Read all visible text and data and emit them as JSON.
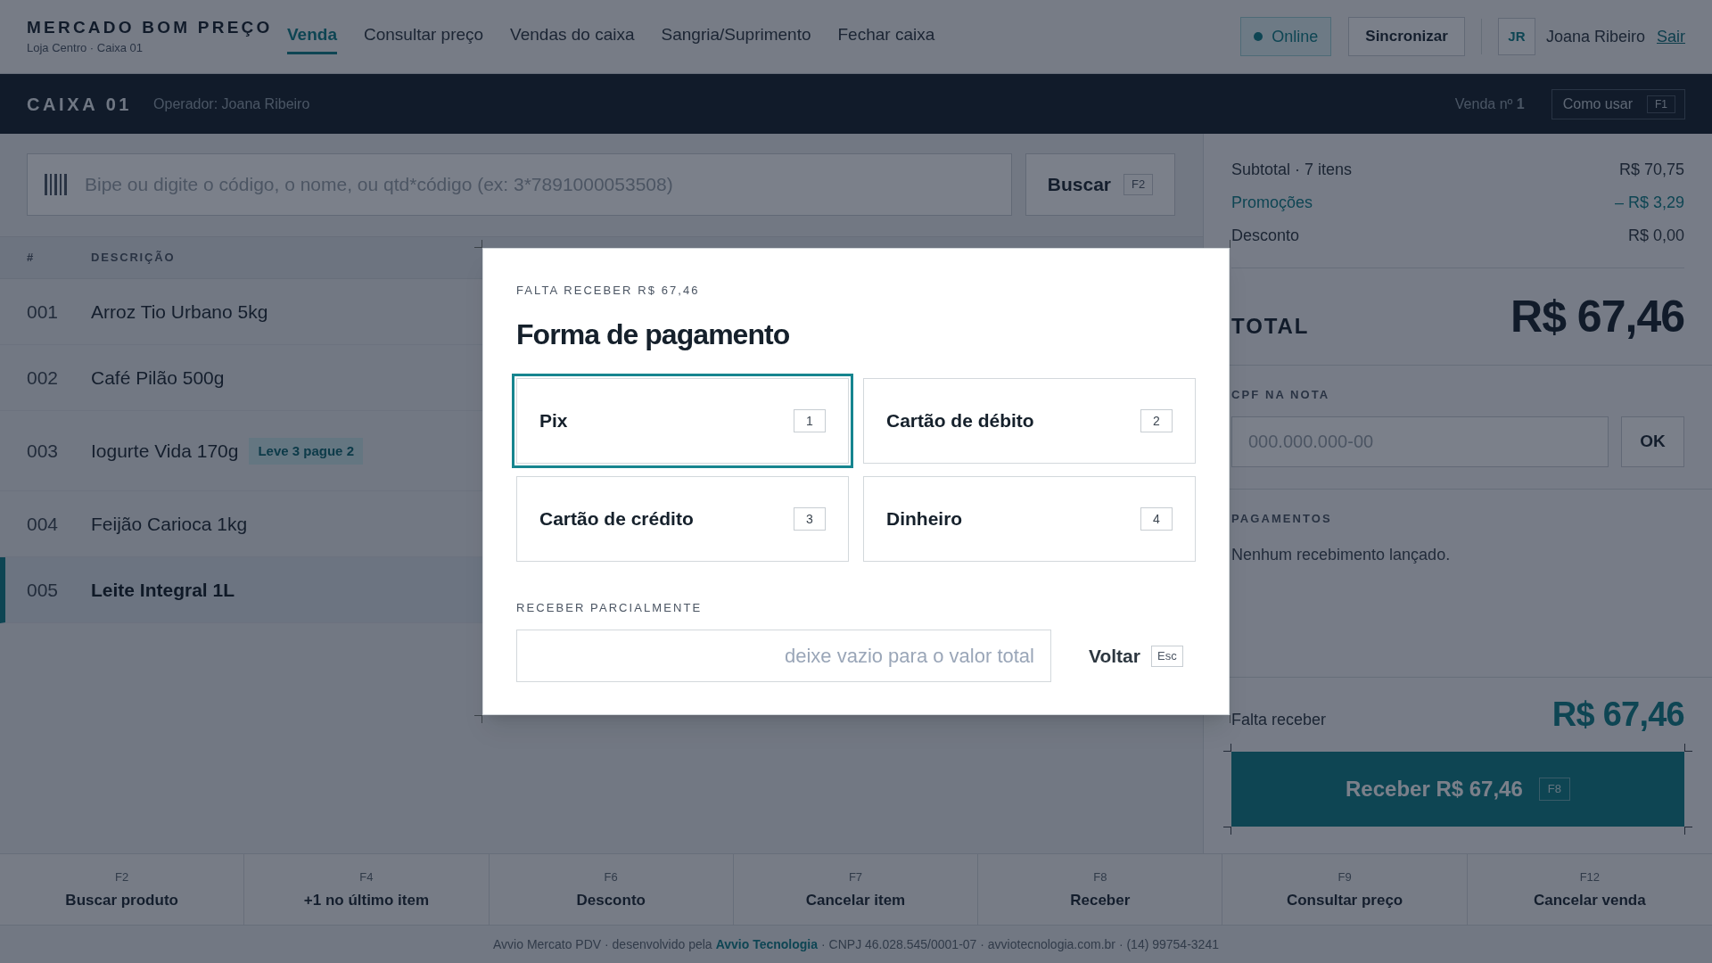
{
  "header": {
    "brand": "MERCADO BOM PREÇO",
    "store": "Loja Centro · Caixa 01",
    "nav": [
      {
        "label": "Venda",
        "selected": true
      },
      {
        "label": "Consultar preço",
        "selected": false
      },
      {
        "label": "Vendas do caixa",
        "selected": false
      },
      {
        "label": "Sangria/Suprimento",
        "selected": false
      },
      {
        "label": "Fechar caixa",
        "selected": false
      }
    ],
    "status": "Online",
    "sync_button": "Sincronizar",
    "user_initials": "JR",
    "user_name": "Joana Ribeiro",
    "logout": "Sair"
  },
  "register_bar": {
    "title": "CAIXA 01",
    "operator": "Operador: Joana Ribeiro",
    "sale": "Venda nº **1**",
    "help_button": {
      "label": "Como usar",
      "key": "F1"
    }
  },
  "search": {
    "placeholder": "Bipe ou digite o código, o nome, ou qtd*código (ex: 3*7891000053508)",
    "button": {
      "label": "Buscar",
      "key": "F2"
    }
  },
  "items_table": {
    "columns": [
      "#",
      "DESCRIÇÃO"
    ],
    "rows": [
      {
        "number": "001",
        "description": "Arroz Tio Urbano 5kg",
        "selected": false
      },
      {
        "number": "002",
        "description": "Café Pilão 500g",
        "selected": false
      },
      {
        "number": "003",
        "description": "Iogurte Vida 170g",
        "badge": "Leve 3 pague 2",
        "selected": false
      },
      {
        "number": "004",
        "description": "Feijão Carioca 1kg",
        "selected": false
      },
      {
        "number": "005",
        "description": "Leite Integral 1L",
        "selected": true
      }
    ]
  },
  "summary": {
    "lines": [
      {
        "label": "Subtotal · 7 itens",
        "value": "R$ 70,75",
        "kind": "normal"
      },
      {
        "label": "Promoções",
        "value": "– R$ 3,29",
        "kind": "promo"
      },
      {
        "label": "Desconto",
        "value": "R$ 0,00",
        "kind": "normal"
      }
    ],
    "total_label": "TOTAL",
    "total_value": "R$ 67,46",
    "cpf": {
      "label": "CPF NA NOTA",
      "placeholder": "000.000.000-00",
      "button": "OK"
    },
    "payments": {
      "label": "PAGAMENTOS",
      "empty_text": "Nenhum recebimento lançado."
    },
    "remaining_label": "Falta receber",
    "remaining_value": "R$ 67,46",
    "receive_button": {
      "label": "Receber R$ 67,46",
      "key": "F8"
    }
  },
  "function_keys": [
    {
      "key": "F2",
      "label": "Buscar produto"
    },
    {
      "key": "F4",
      "label": "+1 no último item"
    },
    {
      "key": "F6",
      "label": "Desconto"
    },
    {
      "key": "F7",
      "label": "Cancelar item"
    },
    {
      "key": "F8",
      "label": "Receber"
    },
    {
      "key": "F9",
      "label": "Consultar preço"
    },
    {
      "key": "F12",
      "label": "Cancelar venda"
    }
  ],
  "footer": {
    "text_before": "Avvio Mercato PDV · desenvolvido pela",
    "link": "Avvio Tecnologia",
    "text_after": "· CNPJ 46.028.545/0001-07 · avviotecnologia.com.br · (14) 99754-3241"
  },
  "payment_modal": {
    "eyebrow": "FALTA RECEBER R$ 67,46",
    "title": "Forma de pagamento",
    "options": [
      {
        "label": "Pix",
        "key": "1",
        "selected": true
      },
      {
        "label": "Cartão de débito",
        "key": "2",
        "selected": false
      },
      {
        "label": "Cartão de crédito",
        "key": "3",
        "selected": false
      },
      {
        "label": "Dinheiro",
        "key": "4",
        "selected": false
      }
    ],
    "partial": {
      "label": "RECEBER PARCIALMENTE",
      "placeholder": "deixe vazio para o valor total"
    },
    "back_button": {
      "label": "Voltar",
      "key": "Esc"
    }
  }
}
